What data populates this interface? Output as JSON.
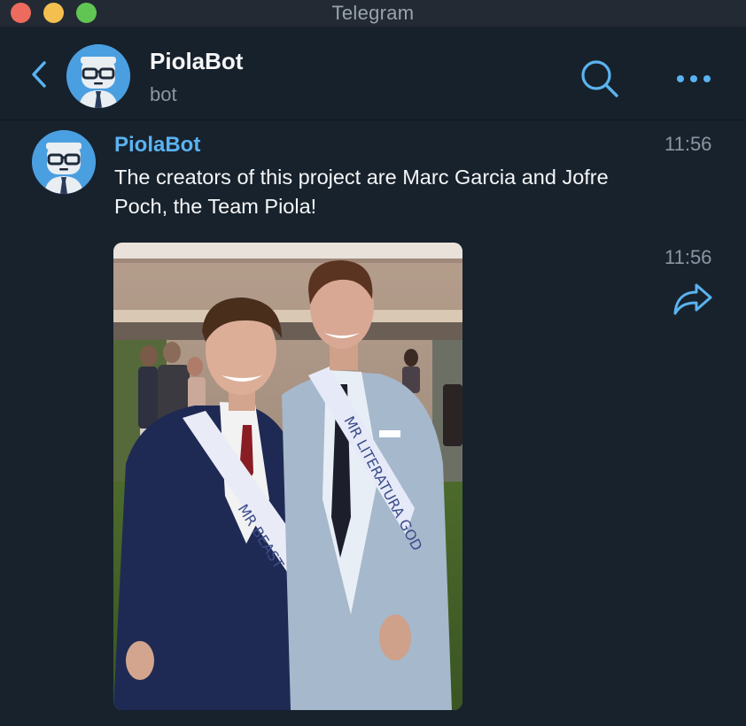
{
  "window": {
    "title": "Telegram"
  },
  "header": {
    "chat_name": "PiolaBot",
    "chat_status": "bot",
    "icons": [
      "back-chevron-icon",
      "bot-avatar",
      "search-icon",
      "more-dots-icon"
    ]
  },
  "messages": [
    {
      "sender": "PiolaBot",
      "text": "The creators of this project are Marc Garcia and Jofre Poch, the Team Piola!",
      "time": "11:56"
    },
    {
      "type": "photo",
      "time": "11:56",
      "sash_left": "MR BEAST",
      "sash_right": "MR LITERATURA GOD",
      "icon": "forward-arrow-icon"
    }
  ],
  "colors": {
    "background": "#18222d",
    "accent": "#5ab3f0",
    "muted": "#8a96a3"
  }
}
